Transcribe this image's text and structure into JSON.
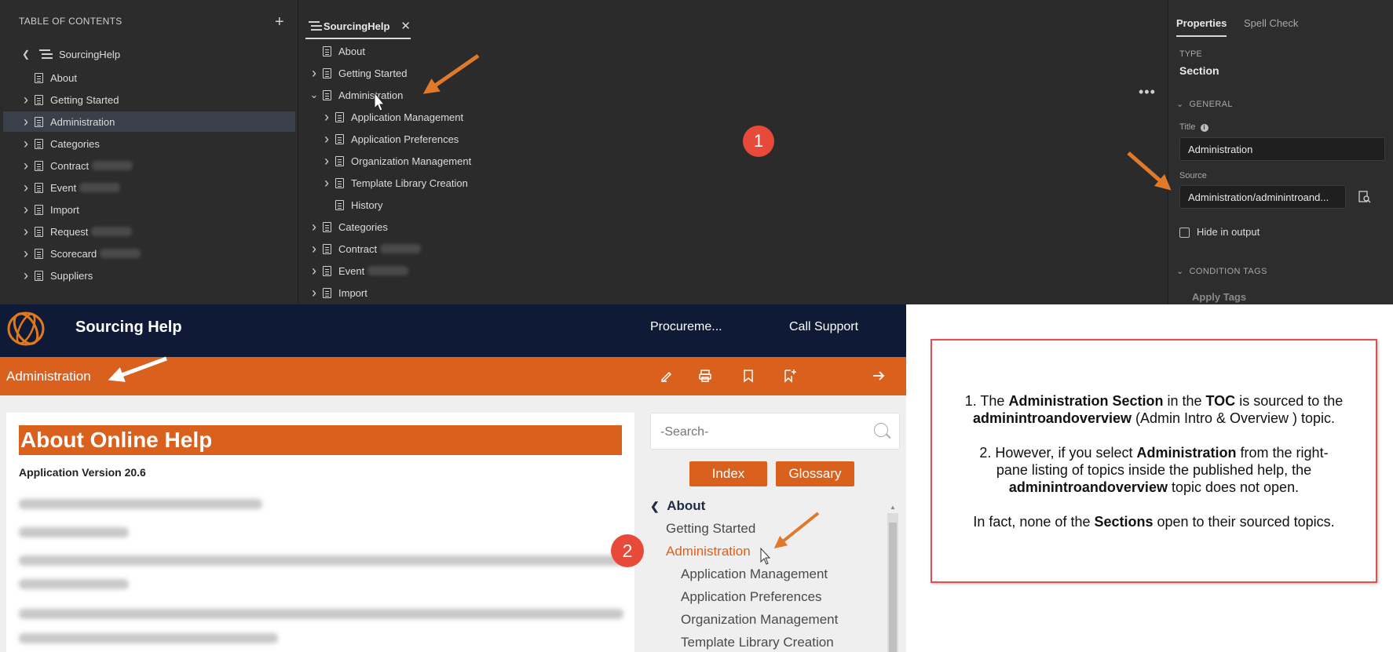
{
  "editor": {
    "toc_header": "TABLE OF CONTENTS",
    "toc_root": "SourcingHelp",
    "toc_items": [
      {
        "label": "About",
        "chevron": false
      },
      {
        "label": "Getting Started",
        "chevron": true
      },
      {
        "label": "Administration",
        "chevron": true,
        "selected": true
      },
      {
        "label": "Categories",
        "chevron": true
      },
      {
        "label": "Contract",
        "chevron": true,
        "blurred": true
      },
      {
        "label": "Event",
        "chevron": true,
        "blurred": true
      },
      {
        "label": "Import",
        "chevron": true
      },
      {
        "label": "Request",
        "chevron": true,
        "blurred": true
      },
      {
        "label": "Scorecard",
        "chevron": true,
        "blurred": true
      },
      {
        "label": "Suppliers",
        "chevron": true
      }
    ],
    "tab_title": "SourcingHelp",
    "tree_items": [
      {
        "label": "About",
        "level": 0,
        "chevron": "none"
      },
      {
        "label": "Getting Started",
        "level": 0,
        "chevron": "right"
      },
      {
        "label": "Administration",
        "level": 0,
        "chevron": "down"
      },
      {
        "label": "Application Management",
        "level": 1,
        "chevron": "right"
      },
      {
        "label": "Application Preferences",
        "level": 1,
        "chevron": "right"
      },
      {
        "label": "Organization Management",
        "level": 1,
        "chevron": "right"
      },
      {
        "label": "Template Library Creation",
        "level": 1,
        "chevron": "right"
      },
      {
        "label": "History",
        "level": 1,
        "chevron": "none"
      },
      {
        "label": "Categories",
        "level": 0,
        "chevron": "right"
      },
      {
        "label": "Contract",
        "level": 0,
        "chevron": "right",
        "blurred": true
      },
      {
        "label": "Event",
        "level": 0,
        "chevron": "right",
        "blurred": true
      },
      {
        "label": "Import",
        "level": 0,
        "chevron": "right"
      }
    ],
    "badge": "1",
    "properties": {
      "tab_properties": "Properties",
      "tab_spell": "Spell Check",
      "type_label": "TYPE",
      "type_value": "Section",
      "general_label": "GENERAL",
      "title_label": "Title",
      "title_value": "Administration",
      "source_label": "Source",
      "source_value": "Administration/adminintroand...",
      "hide_label": "Hide in output",
      "condition_label": "CONDITION TAGS",
      "apply_tags": "Apply Tags"
    }
  },
  "help": {
    "site_title": "Sourcing Help",
    "nav_procurement": "Procureme...",
    "nav_support": "Call Support",
    "breadcrumb": "Administration",
    "heading": "About Online Help",
    "app_version": "Application Version 20.6",
    "search_placeholder": "-Search-",
    "index_btn": "Index",
    "glossary_btn": "Glossary",
    "side_back": "About",
    "side_items": [
      {
        "label": "Getting Started",
        "level": 0
      },
      {
        "label": "Administration",
        "level": 0,
        "active": true
      },
      {
        "label": "Application Management",
        "level": 1
      },
      {
        "label": "Application Preferences",
        "level": 1
      },
      {
        "label": "Organization Management",
        "level": 1
      },
      {
        "label": "Template Library Creation",
        "level": 1
      }
    ],
    "badge": "2",
    "accent": "#d9601d",
    "navy": "#0e1a36"
  },
  "note": {
    "p1_a": "1.  The ",
    "p1_b": "Administration Section",
    "p1_c": " in the ",
    "p1_d": "TOC",
    "p1_e": " is sourced to the ",
    "p1_f": "adminintroandoverview",
    "p1_g": " (Admin Intro & Overview ) topic.",
    "p2_a": "2. However, if you select ",
    "p2_b": "Administration",
    "p2_c": " from the right-pane listing of topics inside the published help, the ",
    "p2_d": "adminintroandoverview",
    "p2_e": " topic does not open.",
    "p3_a": "In fact, none of the ",
    "p3_b": "Sections",
    "p3_c": " open to their sourced topics."
  }
}
